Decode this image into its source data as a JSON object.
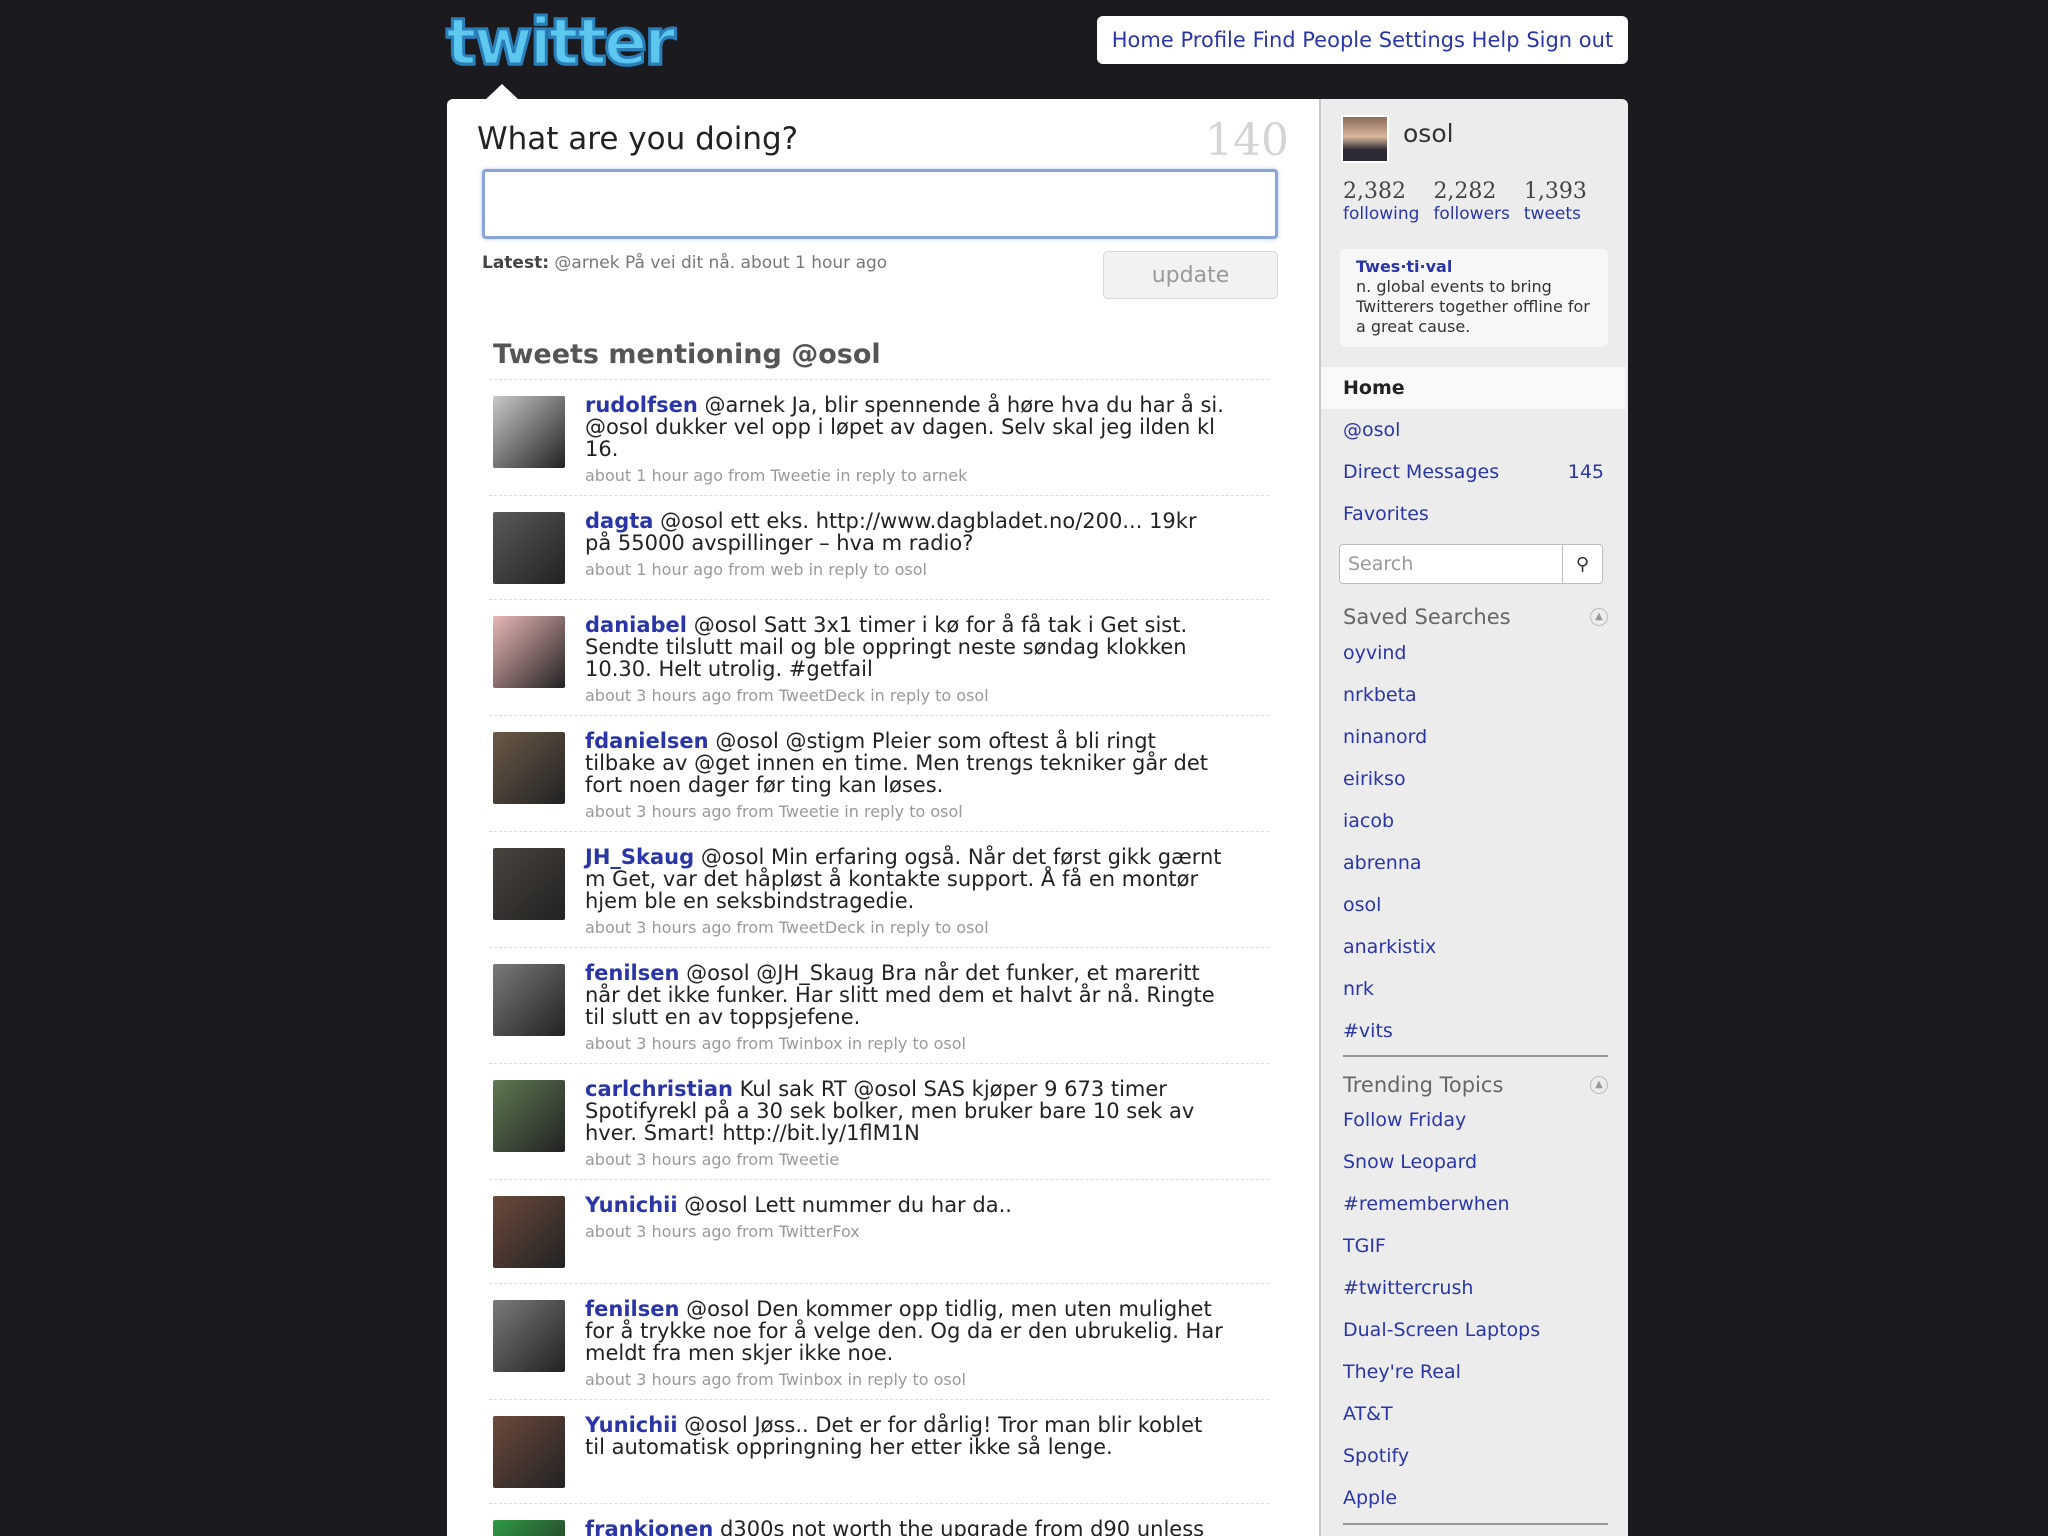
{
  "logo": "twitter",
  "topnav": [
    "Home",
    "Profile",
    "Find People",
    "Settings",
    "Help",
    "Sign out"
  ],
  "status": {
    "prompt": "What are you doing?",
    "counter": "140",
    "latest_label": "Latest:",
    "latest_text": "@arnek På vei dit nå. about 1 hour ago",
    "update_label": "update"
  },
  "section_title": "Tweets mentioning @osol",
  "tweets": [
    {
      "user": "rudolfsen",
      "text": "@arnek Ja, blir spennende å høre hva du har å si. @osol dukker vel opp i løpet av dagen. Selv skal jeg ilden kl 16.",
      "meta": "about 1 hour ago from Tweetie in reply to arnek"
    },
    {
      "user": "dagta",
      "text": "@osol ett eks. http://www.dagbladet.no/200... 19kr på 55000 avspillinger – hva m radio?",
      "meta": "about 1 hour ago from web in reply to osol"
    },
    {
      "user": "daniabel",
      "text": "@osol Satt 3x1 timer i kø for å få tak i Get sist. Sendte tilslutt mail og ble oppringt neste søndag klokken 10.30. Helt utrolig. #getfail",
      "meta": "about 3 hours ago from TweetDeck in reply to osol"
    },
    {
      "user": "fdanielsen",
      "text": "@osol @stigm Pleier som oftest å bli ringt tilbake av @get innen en time. Men trengs tekniker går det fort noen dager før ting kan løses.",
      "meta": "about 3 hours ago from Tweetie in reply to osol"
    },
    {
      "user": "JH_Skaug",
      "text": "@osol Min erfaring også. Når det først gikk gærnt m Get, var det håpløst å kontakte support. Å få en montør hjem ble en seksbindstragedie.",
      "meta": "about 3 hours ago from TweetDeck in reply to osol"
    },
    {
      "user": "fenilsen",
      "text": "@osol @JH_Skaug Bra når det funker, et mareritt når det ikke funker. Har slitt med dem et halvt år nå. Ringte til slutt en av toppsjefene.",
      "meta": "about 3 hours ago from Twinbox in reply to osol"
    },
    {
      "user": "carlchristian",
      "text": "Kul sak RT @osol SAS kjøper 9 673 timer Spotifyrekl på a 30 sek bolker, men bruker bare 10 sek av hver. Smart! http://bit.ly/1flM1N",
      "meta": "about 3 hours ago from Tweetie"
    },
    {
      "user": "Yunichii",
      "text": "@osol Lett nummer du har da..",
      "meta": "about 3 hours ago from TwitterFox"
    },
    {
      "user": "fenilsen",
      "text": "@osol Den kommer opp tidlig, men uten mulighet for å trykke noe for å velge den. Og da er den ubrukelig. Har meldt fra men skjer ikke noe.",
      "meta": "about 3 hours ago from Twinbox in reply to osol"
    },
    {
      "user": "Yunichii",
      "text": "@osol Jøss.. Det er for dårlig! Tror man blir koblet til automatisk oppringning her etter ikke så lenge.",
      "meta": ""
    },
    {
      "user": "frankjonen",
      "text": "d300s not worth the upgrade from d90 unless",
      "meta": ""
    }
  ],
  "sidebar": {
    "username": "osol",
    "stats": [
      {
        "num": "2,382",
        "label": "following"
      },
      {
        "num": "2,282",
        "label": "followers"
      },
      {
        "num": "1,393",
        "label": "tweets"
      }
    ],
    "festival_head": "Twes·ti·val",
    "festival_text": "n. global events to bring Twitterers together offline for a great cause.",
    "menu": [
      {
        "label": "Home",
        "count": ""
      },
      {
        "label": "@osol",
        "count": ""
      },
      {
        "label": "Direct Messages",
        "count": "145"
      },
      {
        "label": "Favorites",
        "count": ""
      }
    ],
    "search_placeholder": "Search",
    "saved_searches_title": "Saved Searches",
    "saved_searches": [
      "oyvind",
      "nrkbeta",
      "ninanord",
      "eirikso",
      "iacob",
      "abrenna",
      "osol",
      "anarkistix",
      "nrk",
      "#vits"
    ],
    "trending_title": "Trending Topics",
    "trending": [
      "Follow Friday",
      "Snow Leopard",
      "#rememberwhen",
      "TGIF",
      "#twittercrush",
      "Dual-Screen Laptops",
      "They're Real",
      "AT&T",
      "Spotify",
      "Apple"
    ]
  },
  "colors": {
    "background": "#1a1a1f",
    "link": "#2a36a8",
    "logo": "#5cc8f0"
  }
}
